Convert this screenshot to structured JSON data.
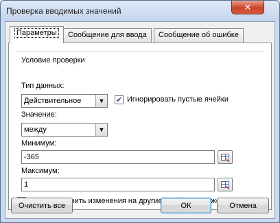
{
  "window": {
    "title": "Проверка вводимых значений",
    "close_glyph": "✕"
  },
  "tabs": [
    {
      "label": "Параметры",
      "active": true
    },
    {
      "label": "Сообщение для ввода",
      "active": false
    },
    {
      "label": "Сообщение об ошибке",
      "active": false
    }
  ],
  "condition": {
    "group_label": "Условие проверки",
    "data_type_label": "Тип данных:",
    "data_type_value": "Действительное",
    "ignore_blank_label": "Игнорировать пустые ячейки",
    "ignore_blank_checked": true,
    "value_label": "Значение:",
    "value_value": "между",
    "min_label": "Минимум:",
    "min_value": "-365",
    "max_label": "Максимум:",
    "max_value": "1"
  },
  "apply_all": {
    "label": "Распространить изменения на другие ячейки с тем же условием",
    "checked": false
  },
  "buttons": {
    "clear_all": "Очистить все",
    "ok": "ОК",
    "cancel": "Отмена"
  },
  "icons": {
    "dropdown": "chevron-down-icon",
    "range_picker": "range-select-icon",
    "check": "✔"
  }
}
